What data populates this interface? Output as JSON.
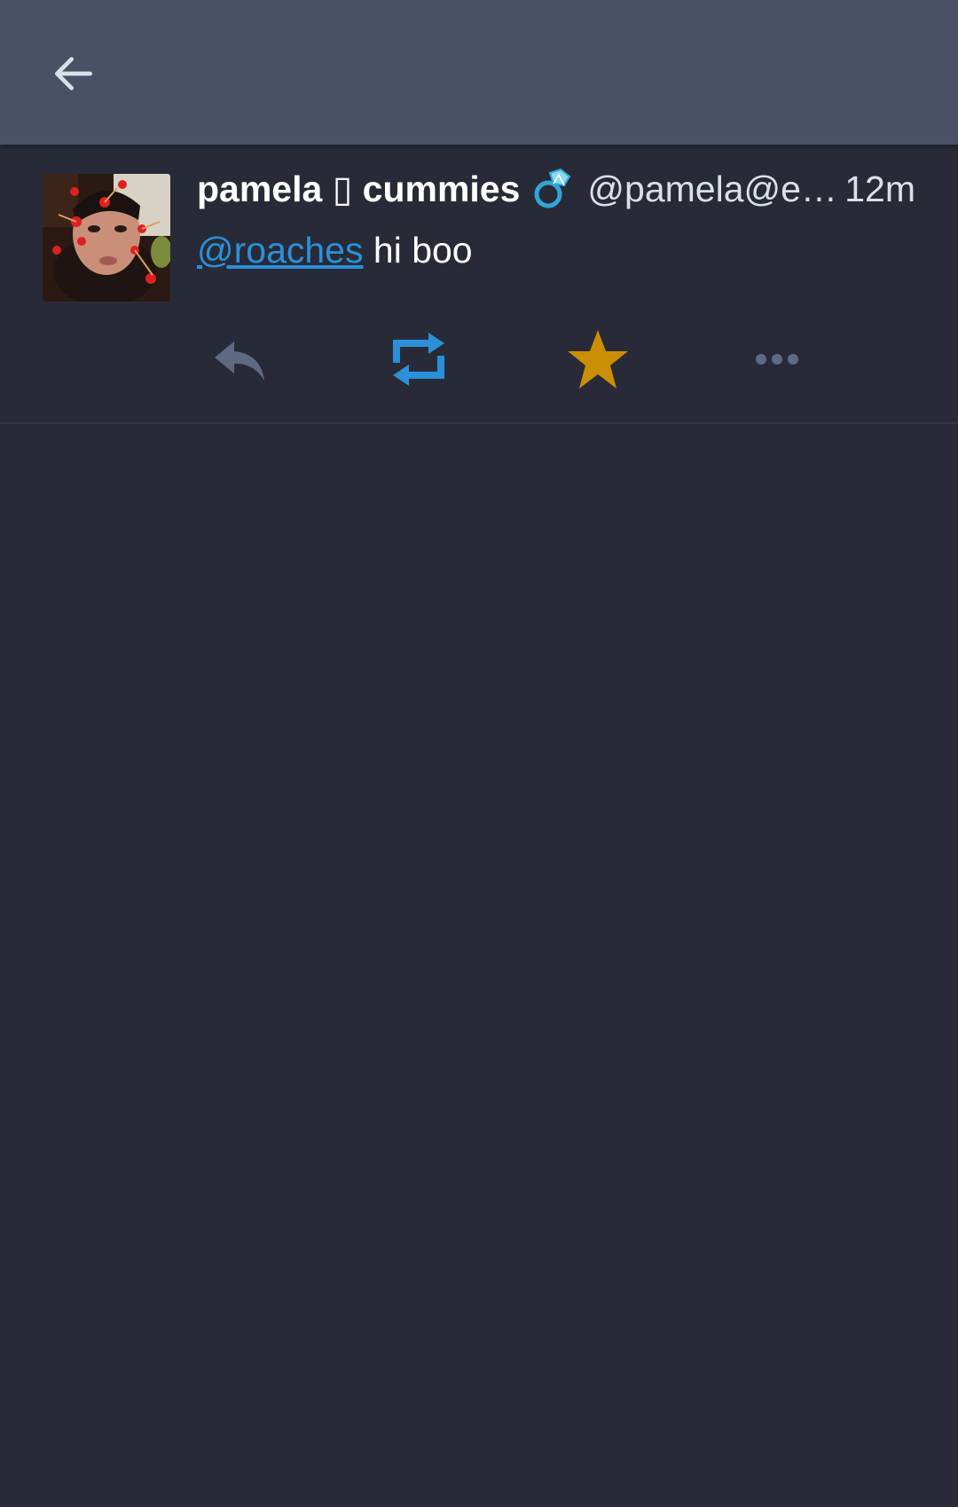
{
  "app_bar": {
    "back_icon": "arrow-left-icon"
  },
  "status": {
    "display_name": "pamela ▯ cummies",
    "name_emoji": "ring-emoji",
    "acct": "@pamela@ehj…",
    "timestamp": "12m",
    "content": {
      "mention": "@roaches",
      "text": "hi boo"
    },
    "actions": [
      {
        "name": "reply",
        "icon": "reply-icon",
        "color": "#606984"
      },
      {
        "name": "boost",
        "icon": "boost-icon",
        "color": "#2b90d9",
        "active": true
      },
      {
        "name": "favourite",
        "icon": "star-icon",
        "color": "#ca8f04",
        "active": true
      },
      {
        "name": "more",
        "icon": "ellipsis-icon",
        "color": "#606984"
      }
    ]
  },
  "colors": {
    "app_bar_bg": "#4a5066",
    "page_bg": "#282b37",
    "link": "#2b90d9",
    "favourite": "#ca8f04",
    "muted_icon": "#606984"
  }
}
